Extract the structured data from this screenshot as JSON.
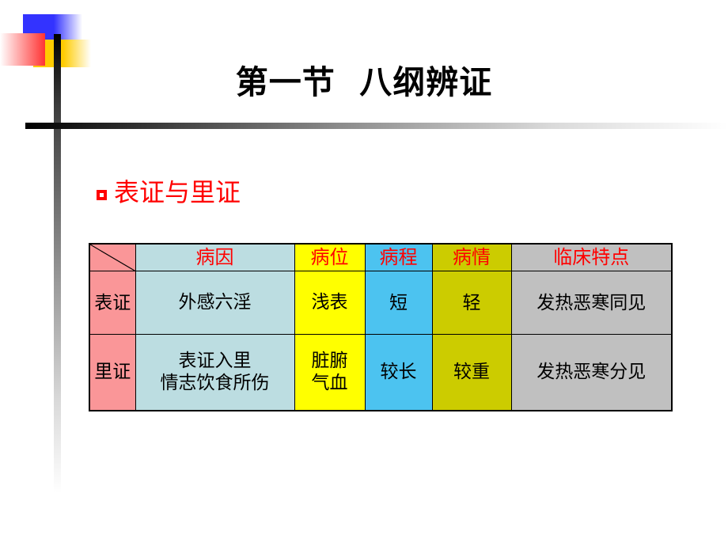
{
  "slide": {
    "title": "第一节  八纲辨证",
    "subtitle": "表证与里证",
    "bullet_icon": "square-outline-bullet-icon",
    "accent_red": "#ff0000",
    "title_color": "#000000"
  },
  "decor": {
    "blue": "#3333ff",
    "yellow": "#ffcc00",
    "red": "#ff3333",
    "rule": "#000000"
  },
  "table": {
    "headers": [
      "",
      "病因",
      "病位",
      "病程",
      "病情",
      "临床特点"
    ],
    "header_colors": [
      "#fa9698",
      "#bcdde1",
      "#ffff00",
      "#4cc3f0",
      "#cccc00",
      "#c0c0c0"
    ],
    "rows": [
      {
        "label": "表证",
        "cause": "外感六淫",
        "cause2": "",
        "site": "浅表",
        "site2": "",
        "course": "短",
        "severity": "轻",
        "feature": "发热恶寒同见"
      },
      {
        "label": "里证",
        "cause": "表证入里",
        "cause2": "情志饮食所伤",
        "site": "脏腑",
        "site2": "气血",
        "course": "较长",
        "severity": "较重",
        "feature": "发热恶寒分见"
      }
    ]
  }
}
